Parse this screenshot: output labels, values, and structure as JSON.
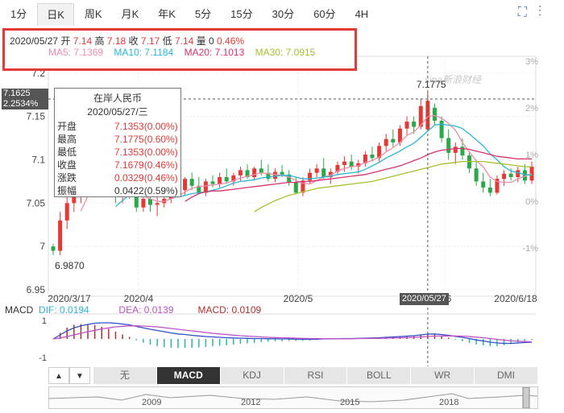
{
  "tabs": {
    "items": [
      "1分",
      "日K",
      "周K",
      "月K",
      "年K",
      "5分",
      "15分",
      "30分",
      "60分",
      "4H"
    ],
    "active": "日K",
    "tools": [
      "fullscreen-icon",
      "more-icon"
    ]
  },
  "info": {
    "date": "2020/05/27",
    "open_label": "开",
    "open": "7.14",
    "high_label": "高",
    "high": "7.18",
    "close_label": "收",
    "close": "7.17",
    "low_label": "低",
    "low": "7.14",
    "vol_label": "量",
    "vol": "0",
    "change": "0.46%",
    "ma5": "MA5: 7.1369",
    "ma10": "MA10: 7.1184",
    "ma20": "MA20: 7.1013",
    "ma30": "MA30: 7.0915",
    "colors": {
      "ma5": "#f08ca8",
      "ma10": "#2bb6d8",
      "ma20": "#d6336c",
      "ma30": "#a8c030"
    }
  },
  "tooltip": {
    "title": "在岸人民币",
    "date": "2020/05/27/三",
    "rows": [
      {
        "k": "开盘",
        "v": "7.1353(0.00%)"
      },
      {
        "k": "最高",
        "v": "7.1775(0.60%)"
      },
      {
        "k": "最低",
        "v": "7.1353(0.00%)"
      },
      {
        "k": "收盘",
        "v": "7.1679(0.46%)"
      },
      {
        "k": "涨跌",
        "v": "0.0329(0.46%)"
      },
      {
        "k": "振幅",
        "v": "0.0422(0.59%)"
      }
    ]
  },
  "crosshair": {
    "price": "7.1625",
    "pct": "2.2534%",
    "date": "2020/05/27"
  },
  "watermark": "sina新浪财经",
  "chart_data": {
    "type": "candlestick",
    "y_ticks": [
      "7.2",
      "7.15",
      "7.1",
      "7.05",
      "7",
      "6.95"
    ],
    "ylim": [
      6.95,
      7.21
    ],
    "pct_ticks": [
      "3%",
      "2%",
      "1%",
      "0%",
      "-1%"
    ],
    "x_ticks": [
      "2020/3/17",
      "2020/4",
      "2020/5",
      "2020/05/27",
      "0/6",
      "2020/6/18"
    ],
    "max_label": "7.1775",
    "min_label": "6.9870",
    "candles": [
      [
        7.0,
        7.003,
        6.99,
        6.995
      ],
      [
        6.995,
        7.04,
        6.99,
        7.03
      ],
      [
        7.03,
        7.06,
        7.02,
        7.05
      ],
      [
        7.05,
        7.07,
        7.04,
        7.06
      ],
      [
        7.06,
        7.08,
        7.05,
        7.07
      ],
      [
        7.07,
        7.09,
        7.06,
        7.08
      ],
      [
        7.08,
        7.09,
        7.06,
        7.07
      ],
      [
        7.07,
        7.08,
        7.06,
        7.075
      ],
      [
        7.075,
        7.09,
        7.06,
        7.065
      ],
      [
        7.065,
        7.075,
        7.05,
        7.06
      ],
      [
        7.06,
        7.075,
        7.05,
        7.07
      ],
      [
        7.07,
        7.08,
        7.055,
        7.06
      ],
      [
        7.06,
        7.07,
        7.04,
        7.045
      ],
      [
        7.045,
        7.06,
        7.04,
        7.055
      ],
      [
        7.055,
        7.065,
        7.04,
        7.048
      ],
      [
        7.048,
        7.06,
        7.035,
        7.05
      ],
      [
        7.05,
        7.065,
        7.045,
        7.055
      ],
      [
        7.055,
        7.07,
        7.05,
        7.068
      ],
      [
        7.068,
        7.075,
        7.06,
        7.065
      ],
      [
        7.065,
        7.08,
        7.06,
        7.078
      ],
      [
        7.078,
        7.085,
        7.065,
        7.07
      ],
      [
        7.07,
        7.08,
        7.06,
        7.062
      ],
      [
        7.062,
        7.078,
        7.058,
        7.075
      ],
      [
        7.075,
        7.082,
        7.068,
        7.072
      ],
      [
        7.072,
        7.085,
        7.068,
        7.08
      ],
      [
        7.08,
        7.09,
        7.072,
        7.075
      ],
      [
        7.075,
        7.085,
        7.07,
        7.082
      ],
      [
        7.082,
        7.092,
        7.075,
        7.088
      ],
      [
        7.088,
        7.095,
        7.078,
        7.08
      ],
      [
        7.08,
        7.092,
        7.076,
        7.09
      ],
      [
        7.09,
        7.1,
        7.082,
        7.085
      ],
      [
        7.085,
        7.095,
        7.075,
        7.078
      ],
      [
        7.078,
        7.09,
        7.074,
        7.086
      ],
      [
        7.086,
        7.094,
        7.08,
        7.083
      ],
      [
        7.083,
        7.088,
        7.07,
        7.074
      ],
      [
        7.074,
        7.08,
        7.06,
        7.062
      ],
      [
        7.062,
        7.08,
        7.058,
        7.076
      ],
      [
        7.076,
        7.09,
        7.072,
        7.085
      ],
      [
        7.085,
        7.095,
        7.08,
        7.09
      ],
      [
        7.09,
        7.102,
        7.078,
        7.08
      ],
      [
        7.08,
        7.09,
        7.072,
        7.086
      ],
      [
        7.086,
        7.098,
        7.082,
        7.094
      ],
      [
        7.094,
        7.104,
        7.086,
        7.098
      ],
      [
        7.098,
        7.106,
        7.088,
        7.092
      ],
      [
        7.092,
        7.1,
        7.084,
        7.096
      ],
      [
        7.096,
        7.11,
        7.092,
        7.106
      ],
      [
        7.106,
        7.115,
        7.098,
        7.102
      ],
      [
        7.102,
        7.12,
        7.098,
        7.116
      ],
      [
        7.116,
        7.13,
        7.11,
        7.124
      ],
      [
        7.124,
        7.135,
        7.115,
        7.12
      ],
      [
        7.12,
        7.14,
        7.116,
        7.136
      ],
      [
        7.136,
        7.15,
        7.128,
        7.144
      ],
      [
        7.144,
        7.15,
        7.13,
        7.138
      ],
      [
        7.138,
        7.17,
        7.135,
        7.162
      ],
      [
        7.135,
        7.178,
        7.135,
        7.168
      ],
      [
        7.16,
        7.165,
        7.14,
        7.145
      ],
      [
        7.145,
        7.15,
        7.12,
        7.125
      ],
      [
        7.125,
        7.135,
        7.1,
        7.108
      ],
      [
        7.108,
        7.12,
        7.095,
        7.115
      ],
      [
        7.115,
        7.125,
        7.1,
        7.105
      ],
      [
        7.105,
        7.11,
        7.085,
        7.09
      ],
      [
        7.09,
        7.1,
        7.07,
        7.075
      ],
      [
        7.075,
        7.085,
        7.062,
        7.068
      ],
      [
        7.068,
        7.078,
        7.058,
        7.062
      ],
      [
        7.062,
        7.082,
        7.06,
        7.078
      ],
      [
        7.078,
        7.088,
        7.07,
        7.084
      ],
      [
        7.084,
        7.09,
        7.076,
        7.08
      ],
      [
        7.08,
        7.092,
        7.074,
        7.088
      ],
      [
        7.088,
        7.095,
        7.072,
        7.076
      ],
      [
        7.076,
        7.098,
        7.072,
        7.092
      ]
    ],
    "ma_series": [
      {
        "name": "MA5",
        "values": [
          null,
          null,
          null,
          null,
          7.041,
          7.058,
          7.066,
          7.071,
          7.073,
          7.07,
          7.068,
          7.066,
          7.06,
          7.058,
          7.055,
          7.052,
          7.052,
          7.055,
          7.058,
          7.063,
          7.067,
          7.069,
          7.07,
          7.071,
          7.072,
          7.073,
          7.076,
          7.079,
          7.081,
          7.083,
          7.085,
          7.084,
          7.083,
          7.082,
          7.08,
          7.076,
          7.073,
          7.072,
          7.076,
          7.08,
          7.082,
          7.087,
          7.09,
          7.092,
          7.093,
          7.097,
          7.099,
          7.103,
          7.109,
          7.114,
          7.12,
          7.128,
          7.132,
          7.14,
          7.15,
          7.151,
          7.148,
          7.142,
          7.134,
          7.12,
          7.109,
          7.099,
          7.092,
          7.08,
          7.075,
          7.074,
          7.074,
          7.078,
          7.081,
          7.084
        ]
      },
      {
        "name": "MA10",
        "values": [
          null,
          null,
          null,
          null,
          null,
          null,
          null,
          null,
          null,
          7.046,
          7.053,
          7.06,
          7.063,
          7.064,
          7.062,
          7.06,
          7.059,
          7.058,
          7.057,
          7.059,
          7.061,
          7.062,
          7.063,
          7.065,
          7.067,
          7.07,
          7.073,
          7.075,
          7.076,
          7.077,
          7.079,
          7.08,
          7.081,
          7.082,
          7.082,
          7.08,
          7.078,
          7.078,
          7.079,
          7.08,
          7.081,
          7.083,
          7.084,
          7.085,
          7.086,
          7.089,
          7.093,
          7.097,
          7.102,
          7.106,
          7.11,
          7.115,
          7.119,
          7.126,
          7.133,
          7.14,
          7.141,
          7.14,
          7.139,
          7.136,
          7.13,
          7.123,
          7.116,
          7.107,
          7.1,
          7.092,
          7.087,
          7.085,
          7.083,
          7.082
        ]
      },
      {
        "name": "MA20",
        "values": [
          null,
          null,
          null,
          null,
          null,
          null,
          null,
          null,
          null,
          null,
          null,
          null,
          null,
          null,
          null,
          null,
          null,
          null,
          null,
          7.052,
          7.057,
          7.061,
          7.063,
          7.064,
          7.064,
          7.065,
          7.066,
          7.067,
          7.068,
          7.069,
          7.07,
          7.071,
          7.072,
          7.073,
          7.074,
          7.074,
          7.075,
          7.075,
          7.076,
          7.077,
          7.078,
          7.079,
          7.08,
          7.081,
          7.082,
          7.083,
          7.085,
          7.087,
          7.089,
          7.091,
          7.093,
          7.096,
          7.099,
          7.102,
          7.106,
          7.109,
          7.111,
          7.112,
          7.113,
          7.113,
          7.112,
          7.11,
          7.108,
          7.106,
          7.104,
          7.103,
          7.102,
          7.101,
          7.101,
          7.101
        ]
      },
      {
        "name": "MA30",
        "values": [
          null,
          null,
          null,
          null,
          null,
          null,
          null,
          null,
          null,
          null,
          null,
          null,
          null,
          null,
          null,
          null,
          null,
          null,
          null,
          null,
          null,
          null,
          null,
          null,
          null,
          null,
          null,
          null,
          null,
          7.04,
          7.045,
          7.049,
          7.053,
          7.056,
          7.059,
          7.061,
          7.063,
          7.065,
          7.067,
          7.068,
          7.069,
          7.07,
          7.071,
          7.072,
          7.073,
          7.074,
          7.075,
          7.077,
          7.079,
          7.081,
          7.083,
          7.085,
          7.087,
          7.089,
          7.091,
          7.093,
          7.095,
          7.096,
          7.097,
          7.098,
          7.098,
          7.098,
          7.098,
          7.097,
          7.096,
          7.095,
          7.094,
          7.093,
          7.092,
          7.092
        ]
      }
    ],
    "macd": {
      "dif_label": "DIF: 0.0194",
      "dea_label": "DEA: 0.0139",
      "macd_label": "MACD: 0.0109",
      "y_ticks": [
        "1",
        "-1"
      ],
      "dif": [
        0.0,
        0.2,
        0.4,
        0.55,
        0.65,
        0.72,
        0.78,
        0.8,
        0.8,
        0.78,
        0.74,
        0.7,
        0.62,
        0.55,
        0.48,
        0.42,
        0.36,
        0.3,
        0.25,
        0.22,
        0.18,
        0.15,
        0.12,
        0.1,
        0.08,
        0.06,
        0.05,
        0.04,
        0.03,
        0.02,
        0.02,
        0.01,
        0.01,
        0.0,
        0.0,
        -0.01,
        -0.02,
        -0.02,
        -0.01,
        0.0,
        0.0,
        0.01,
        0.02,
        0.02,
        0.03,
        0.04,
        0.05,
        0.06,
        0.08,
        0.1,
        0.12,
        0.14,
        0.16,
        0.2,
        0.24,
        0.25,
        0.22,
        0.18,
        0.13,
        0.08,
        0.02,
        -0.05,
        -0.1,
        -0.16,
        -0.2,
        -0.22,
        -0.22,
        -0.2,
        -0.18,
        -0.16
      ],
      "dea": [
        0.0,
        0.05,
        0.12,
        0.2,
        0.28,
        0.36,
        0.43,
        0.5,
        0.55,
        0.6,
        0.63,
        0.65,
        0.65,
        0.64,
        0.62,
        0.6,
        0.56,
        0.52,
        0.48,
        0.44,
        0.4,
        0.36,
        0.32,
        0.28,
        0.25,
        0.22,
        0.19,
        0.16,
        0.14,
        0.12,
        0.1,
        0.08,
        0.07,
        0.06,
        0.05,
        0.04,
        0.03,
        0.02,
        0.02,
        0.01,
        0.01,
        0.01,
        0.01,
        0.01,
        0.02,
        0.02,
        0.03,
        0.03,
        0.04,
        0.05,
        0.06,
        0.07,
        0.08,
        0.1,
        0.12,
        0.14,
        0.15,
        0.15,
        0.15,
        0.14,
        0.12,
        0.09,
        0.06,
        0.02,
        -0.02,
        -0.06,
        -0.09,
        -0.11,
        -0.13,
        -0.14
      ],
      "hist_colors": {
        "up": "#b03030",
        "down": "#2bb6a8"
      }
    }
  },
  "indicator_tabs": [
    "无",
    "MACD",
    "KDJ",
    "RSI",
    "BOLL",
    "WR",
    "DMI"
  ],
  "indicator_active": "MACD",
  "arrows": [
    "▲",
    "▼"
  ],
  "navigator": {
    "years": [
      "2009",
      "2012",
      "2015",
      "2018"
    ]
  }
}
